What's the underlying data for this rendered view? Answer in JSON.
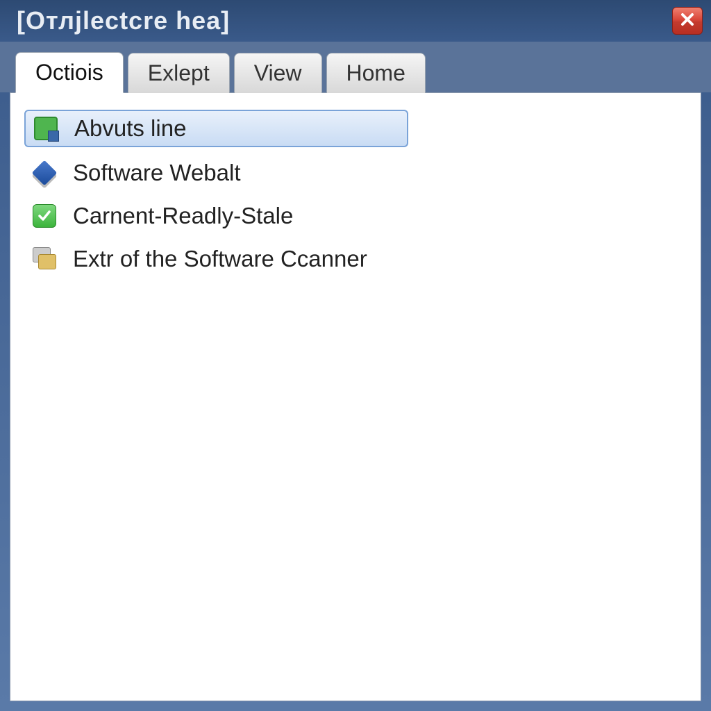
{
  "window": {
    "title": "[Oтлjlectcre hea]"
  },
  "tabs": [
    {
      "label": "Octiois",
      "active": true
    },
    {
      "label": "Exlept",
      "active": false
    },
    {
      "label": "View",
      "active": false
    },
    {
      "label": "Home",
      "active": false
    }
  ],
  "items": [
    {
      "label": "Abvuts line",
      "icon": "box-green",
      "selected": true
    },
    {
      "label": "Software Webalt",
      "icon": "diamond",
      "selected": false
    },
    {
      "label": "Carnent-Readly-Stale",
      "icon": "check",
      "selected": false
    },
    {
      "label": "Extr of the Software Ccanner",
      "icon": "stack",
      "selected": false
    }
  ]
}
